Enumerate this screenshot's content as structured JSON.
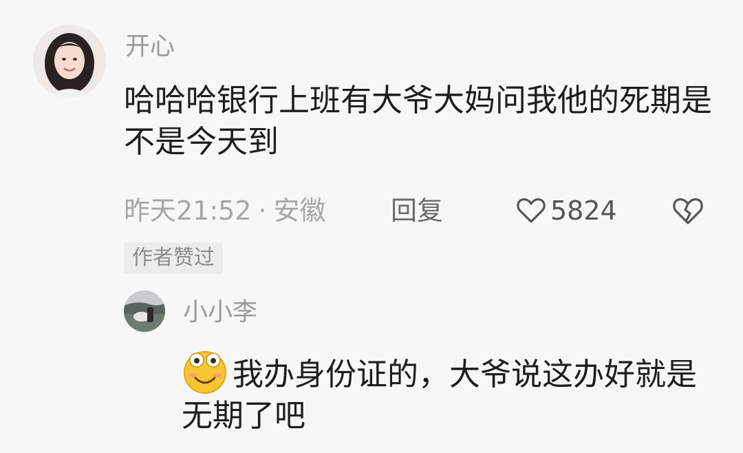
{
  "comment": {
    "username": "开心",
    "text": "哈哈哈银行上班有大爷大妈问我他的死期是不是今天到",
    "time": "昨天21:52",
    "dot": "·",
    "location": "安徽",
    "reply_label": "回复",
    "like_count": "5824",
    "badge": "作者赞过"
  },
  "reply": {
    "username": "小小李",
    "emoji": "smile-emoji",
    "text": "我办身份证的，大爷说这办好就是无期了吧"
  },
  "colors": {
    "background": "#f7f7f7",
    "text": "#1e1e1e",
    "muted": "#9a9a9a",
    "badge_bg": "#ececec",
    "emoji_yellow": "#f7c531"
  }
}
